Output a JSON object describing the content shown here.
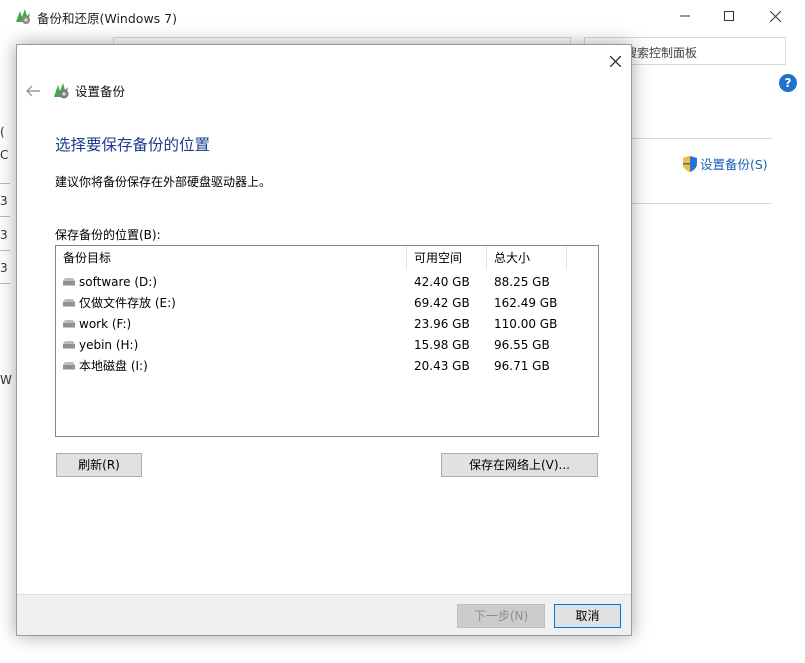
{
  "background_window": {
    "title": "备份和还原(Windows 7)",
    "search_placeholder": "搜索控制面板",
    "help_label": "?",
    "setup_backup_link": "设置备份(S)",
    "left_marks": [
      "(",
      "C",
      "3",
      "3",
      "3",
      "W"
    ]
  },
  "dialog": {
    "nav_title": "设置备份",
    "heading": "选择要保存备份的位置",
    "description": "建议你将备份保存在外部硬盘驱动器上。",
    "list_label": "保存备份的位置(B):",
    "columns": [
      "备份目标",
      "可用空间",
      "总大小"
    ],
    "rows": [
      {
        "name": "software (D:)",
        "free": "42.40 GB",
        "total": "88.25 GB"
      },
      {
        "name": "仅做文件存放 (E:)",
        "free": "69.42 GB",
        "total": "162.49 GB"
      },
      {
        "name": "work (F:)",
        "free": "23.96 GB",
        "total": "110.00 GB"
      },
      {
        "name": "yebin (H:)",
        "free": "15.98 GB",
        "total": "96.55 GB"
      },
      {
        "name": "本地磁盘 (I:)",
        "free": "20.43 GB",
        "total": "96.71 GB"
      }
    ],
    "refresh_button": "刷新(R)",
    "save_network_button": "保存在网络上(V)...",
    "next_button": "下一步(N)",
    "cancel_button": "取消"
  },
  "colors": {
    "heading": "#1a3e8c",
    "link": "#1a5fb4",
    "accent": "#0078d7"
  }
}
